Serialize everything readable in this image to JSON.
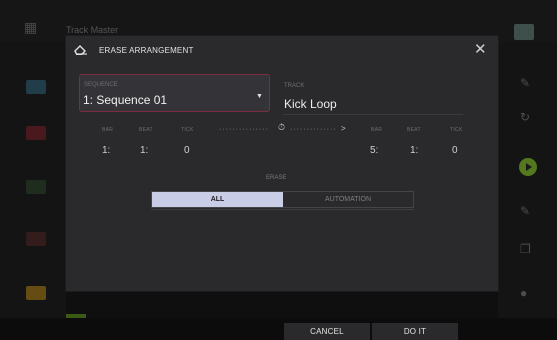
{
  "background": {
    "title_small": "",
    "title": "Track Master"
  },
  "dialog": {
    "title": "ERASE ARRANGEMENT",
    "close_icon": "close-icon",
    "sequence": {
      "label": "SEQUENCE",
      "value": "1: Sequence 01",
      "dropdown_icon": "triangle-down-icon"
    },
    "track": {
      "label": "TRACK",
      "value": "Kick Loop"
    },
    "start": {
      "bar_label": "BAR",
      "beat_label": "BEAT",
      "tick_label": "TICK",
      "bar": "1:",
      "beat": "1:",
      "tick": "0"
    },
    "end": {
      "bar_label": "BAR",
      "beat_label": "BEAT",
      "tick_label": "TICK",
      "bar": "5:",
      "beat": "1:",
      "tick": "0"
    },
    "range_dots_left": "···············",
    "range_dots_right": "··············",
    "stopwatch_icon": "stopwatch-icon",
    "range_arrow": ">",
    "erase_label": "ERASE",
    "erase_options": {
      "all": "ALL",
      "automation": "AUTOMATION",
      "selected": "ALL"
    }
  },
  "footer": {
    "cancel": "CANCEL",
    "do_it": "DO IT"
  },
  "colors": {
    "accent_border": "#7a2e44",
    "selected_segment": "#c9cde6",
    "play_green": "#5f8a1f"
  }
}
